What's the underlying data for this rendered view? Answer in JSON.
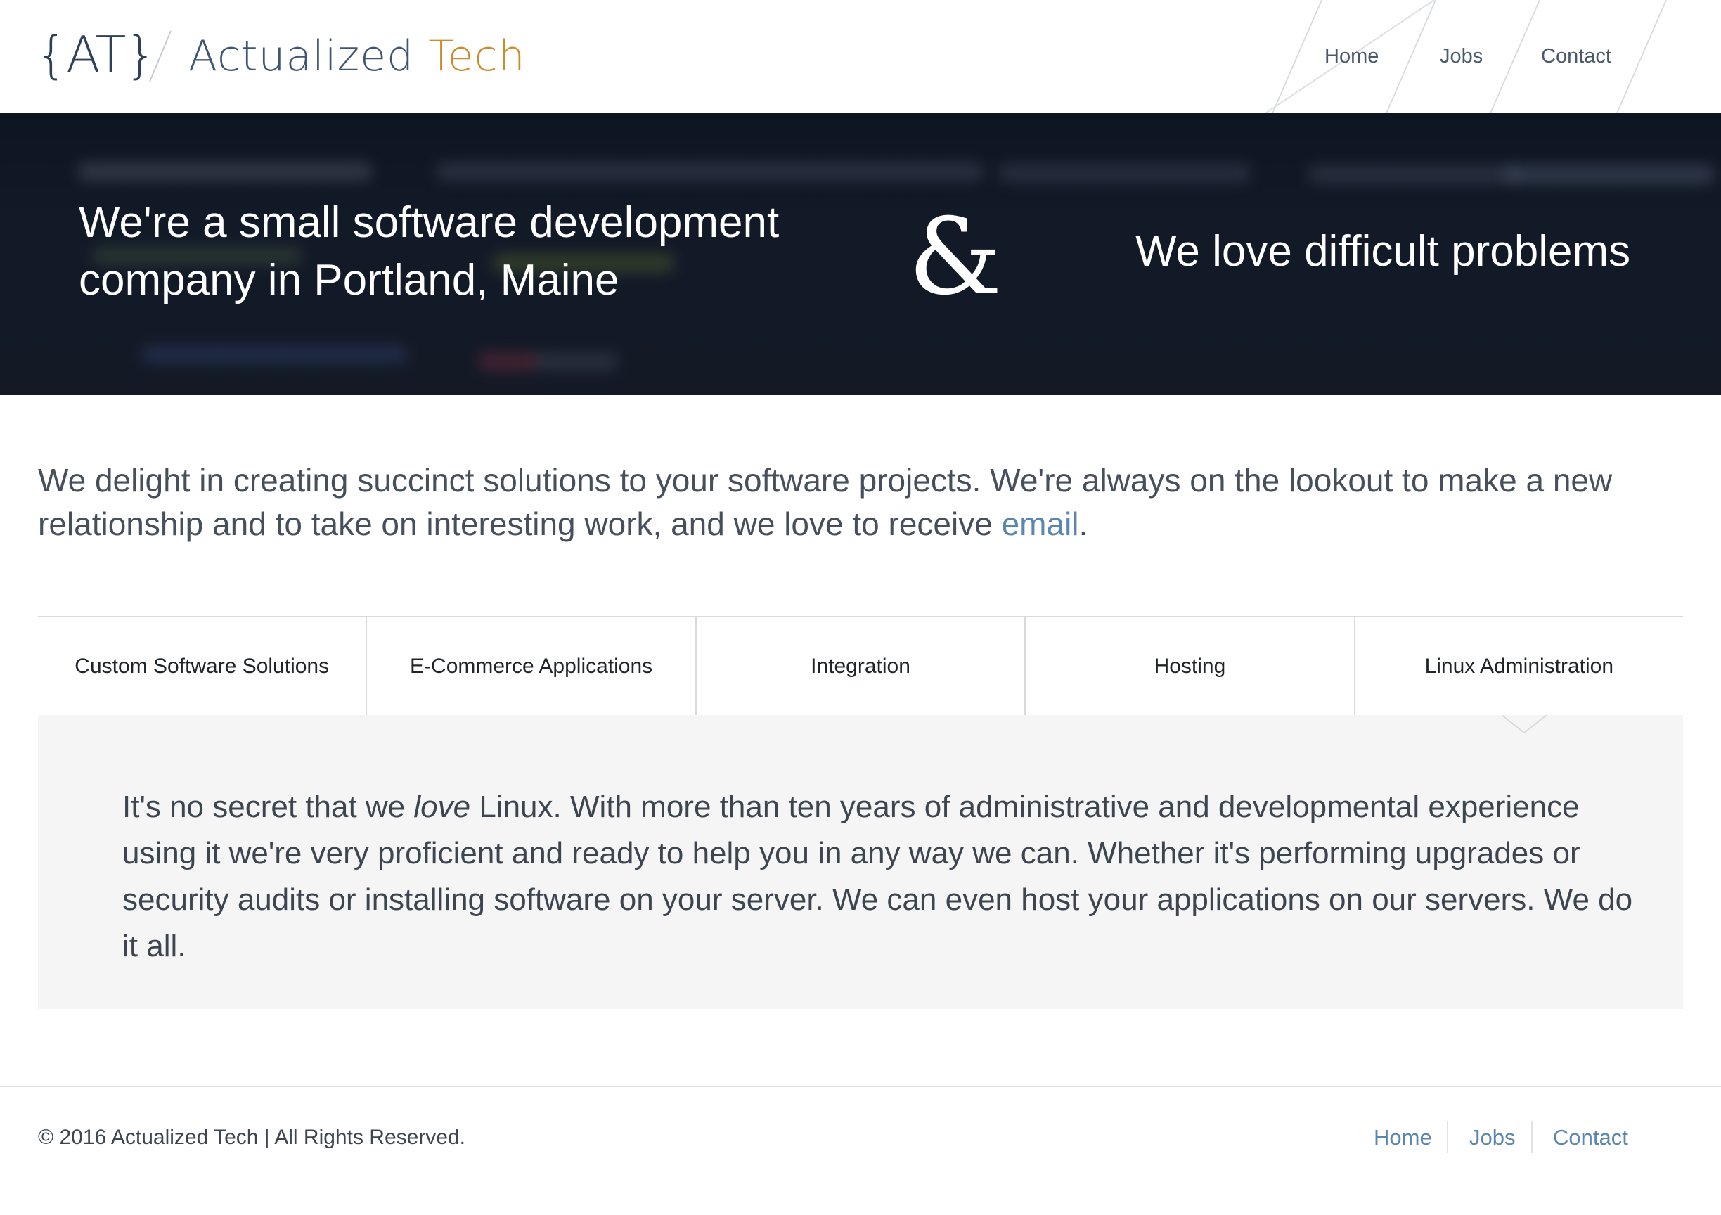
{
  "header": {
    "logo_mark": "{AT}",
    "brand_name_primary": "Actualized",
    "brand_name_secondary": "Tech",
    "nav": [
      {
        "label": "Home"
      },
      {
        "label": "Jobs"
      },
      {
        "label": "Contact"
      }
    ]
  },
  "hero": {
    "left_text": "We're a small software development company in Portland, Maine",
    "ampersand": "&",
    "right_text": "We love difficult problems"
  },
  "intro": {
    "text_before_link": "We delight in creating succinct solutions to your software projects. We're always on the lookout to make a new relationship and to take on interesting work, and we love to receive ",
    "link_text": "email",
    "text_after_link": "."
  },
  "services": {
    "tabs": [
      {
        "label": "Custom Software Solutions"
      },
      {
        "label": "E-Commerce Applications"
      },
      {
        "label": "Integration"
      },
      {
        "label": "Hosting"
      },
      {
        "label": "Linux Administration"
      }
    ],
    "active_tab": "Linux Administration",
    "panel": {
      "text_before_em": "It's no secret that we ",
      "em_text": "love",
      "text_after_em": " Linux. With more than ten years of administrative and developmental experience using it we're very proficient and ready to help you in any way we can. Whether it's performing upgrades or security audits or installing software on your server. We can even host your applications on our servers. We do it all."
    }
  },
  "footer": {
    "copyright": "© 2016 Actualized Tech | All Rights Reserved.",
    "nav": [
      {
        "label": "Home"
      },
      {
        "label": "Jobs"
      },
      {
        "label": "Contact"
      }
    ]
  },
  "colors": {
    "brand_primary": "#3e5676",
    "brand_accent": "#c98d2e",
    "link": "#5b86ad",
    "hero_bg": "#121a28",
    "panel_bg": "#f5f5f5"
  }
}
